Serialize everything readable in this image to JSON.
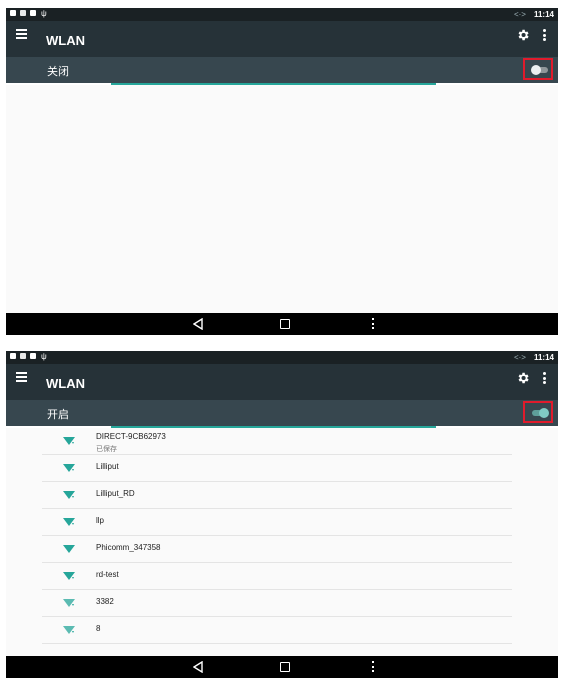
{
  "colors": {
    "appbar": "#263238",
    "switchbar": "#37474f",
    "accent": "#26a69a",
    "highlight_frame": "#e01b2c"
  },
  "status_bar": {
    "time": "11:14",
    "sync_glyph": "<·>"
  },
  "screen_off": {
    "title": "WLAN",
    "switch_label": "关闭",
    "switch_on": false
  },
  "screen_on": {
    "title": "WLAN",
    "switch_label": "开启",
    "switch_on": true,
    "networks": [
      {
        "ssid": "DIRECT-9CB62973",
        "status": "已保存"
      },
      {
        "ssid": "Lilliput",
        "status": ""
      },
      {
        "ssid": "Lilliput_RD",
        "status": ""
      },
      {
        "ssid": "llp",
        "status": ""
      },
      {
        "ssid": "Phicomm_347358",
        "status": ""
      },
      {
        "ssid": "rd-test",
        "status": ""
      },
      {
        "ssid": "3382",
        "status": ""
      },
      {
        "ssid": "8",
        "status": ""
      }
    ]
  },
  "icons": {
    "menu": "hamburger-icon",
    "settings": "gear-icon",
    "overflow": "more-vert-icon",
    "wifi": "wifi-signal-icon",
    "nav_back": "back-triangle-icon",
    "nav_home": "home-square-icon",
    "nav_menu": "menu-dots-icon"
  }
}
